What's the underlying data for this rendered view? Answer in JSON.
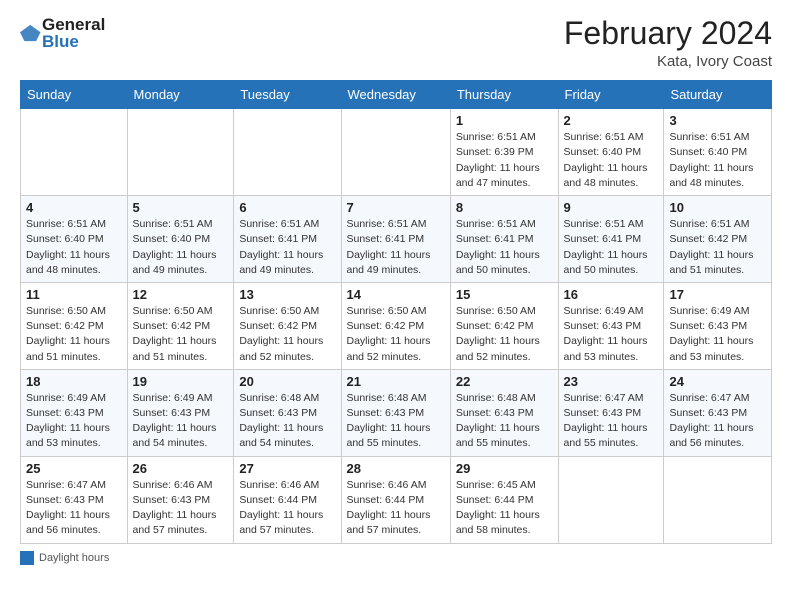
{
  "header": {
    "logo_general": "General",
    "logo_blue": "Blue",
    "title": "February 2024",
    "subtitle": "Kata, Ivory Coast"
  },
  "weekdays": [
    "Sunday",
    "Monday",
    "Tuesday",
    "Wednesday",
    "Thursday",
    "Friday",
    "Saturday"
  ],
  "weeks": [
    [
      {
        "day": "",
        "info": ""
      },
      {
        "day": "",
        "info": ""
      },
      {
        "day": "",
        "info": ""
      },
      {
        "day": "",
        "info": ""
      },
      {
        "day": "1",
        "info": "Sunrise: 6:51 AM\nSunset: 6:39 PM\nDaylight: 11 hours\nand 47 minutes."
      },
      {
        "day": "2",
        "info": "Sunrise: 6:51 AM\nSunset: 6:40 PM\nDaylight: 11 hours\nand 48 minutes."
      },
      {
        "day": "3",
        "info": "Sunrise: 6:51 AM\nSunset: 6:40 PM\nDaylight: 11 hours\nand 48 minutes."
      }
    ],
    [
      {
        "day": "4",
        "info": "Sunrise: 6:51 AM\nSunset: 6:40 PM\nDaylight: 11 hours\nand 48 minutes."
      },
      {
        "day": "5",
        "info": "Sunrise: 6:51 AM\nSunset: 6:40 PM\nDaylight: 11 hours\nand 49 minutes."
      },
      {
        "day": "6",
        "info": "Sunrise: 6:51 AM\nSunset: 6:41 PM\nDaylight: 11 hours\nand 49 minutes."
      },
      {
        "day": "7",
        "info": "Sunrise: 6:51 AM\nSunset: 6:41 PM\nDaylight: 11 hours\nand 49 minutes."
      },
      {
        "day": "8",
        "info": "Sunrise: 6:51 AM\nSunset: 6:41 PM\nDaylight: 11 hours\nand 50 minutes."
      },
      {
        "day": "9",
        "info": "Sunrise: 6:51 AM\nSunset: 6:41 PM\nDaylight: 11 hours\nand 50 minutes."
      },
      {
        "day": "10",
        "info": "Sunrise: 6:51 AM\nSunset: 6:42 PM\nDaylight: 11 hours\nand 51 minutes."
      }
    ],
    [
      {
        "day": "11",
        "info": "Sunrise: 6:50 AM\nSunset: 6:42 PM\nDaylight: 11 hours\nand 51 minutes."
      },
      {
        "day": "12",
        "info": "Sunrise: 6:50 AM\nSunset: 6:42 PM\nDaylight: 11 hours\nand 51 minutes."
      },
      {
        "day": "13",
        "info": "Sunrise: 6:50 AM\nSunset: 6:42 PM\nDaylight: 11 hours\nand 52 minutes."
      },
      {
        "day": "14",
        "info": "Sunrise: 6:50 AM\nSunset: 6:42 PM\nDaylight: 11 hours\nand 52 minutes."
      },
      {
        "day": "15",
        "info": "Sunrise: 6:50 AM\nSunset: 6:42 PM\nDaylight: 11 hours\nand 52 minutes."
      },
      {
        "day": "16",
        "info": "Sunrise: 6:49 AM\nSunset: 6:43 PM\nDaylight: 11 hours\nand 53 minutes."
      },
      {
        "day": "17",
        "info": "Sunrise: 6:49 AM\nSunset: 6:43 PM\nDaylight: 11 hours\nand 53 minutes."
      }
    ],
    [
      {
        "day": "18",
        "info": "Sunrise: 6:49 AM\nSunset: 6:43 PM\nDaylight: 11 hours\nand 53 minutes."
      },
      {
        "day": "19",
        "info": "Sunrise: 6:49 AM\nSunset: 6:43 PM\nDaylight: 11 hours\nand 54 minutes."
      },
      {
        "day": "20",
        "info": "Sunrise: 6:48 AM\nSunset: 6:43 PM\nDaylight: 11 hours\nand 54 minutes."
      },
      {
        "day": "21",
        "info": "Sunrise: 6:48 AM\nSunset: 6:43 PM\nDaylight: 11 hours\nand 55 minutes."
      },
      {
        "day": "22",
        "info": "Sunrise: 6:48 AM\nSunset: 6:43 PM\nDaylight: 11 hours\nand 55 minutes."
      },
      {
        "day": "23",
        "info": "Sunrise: 6:47 AM\nSunset: 6:43 PM\nDaylight: 11 hours\nand 55 minutes."
      },
      {
        "day": "24",
        "info": "Sunrise: 6:47 AM\nSunset: 6:43 PM\nDaylight: 11 hours\nand 56 minutes."
      }
    ],
    [
      {
        "day": "25",
        "info": "Sunrise: 6:47 AM\nSunset: 6:43 PM\nDaylight: 11 hours\nand 56 minutes."
      },
      {
        "day": "26",
        "info": "Sunrise: 6:46 AM\nSunset: 6:43 PM\nDaylight: 11 hours\nand 57 minutes."
      },
      {
        "day": "27",
        "info": "Sunrise: 6:46 AM\nSunset: 6:44 PM\nDaylight: 11 hours\nand 57 minutes."
      },
      {
        "day": "28",
        "info": "Sunrise: 6:46 AM\nSunset: 6:44 PM\nDaylight: 11 hours\nand 57 minutes."
      },
      {
        "day": "29",
        "info": "Sunrise: 6:45 AM\nSunset: 6:44 PM\nDaylight: 11 hours\nand 58 minutes."
      },
      {
        "day": "",
        "info": ""
      },
      {
        "day": "",
        "info": ""
      }
    ]
  ],
  "footer": {
    "daylight_label": "Daylight hours"
  }
}
